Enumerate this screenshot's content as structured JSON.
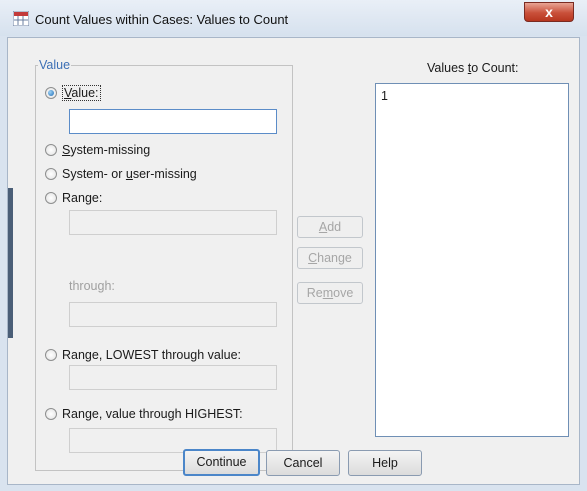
{
  "window": {
    "title": "Count Values within Cases: Values to Count",
    "close_label": "x"
  },
  "value_group": {
    "legend": "Value",
    "options": {
      "value": {
        "pre": "",
        "key": "V",
        "post": "alue:",
        "checked": true
      },
      "system_missing": {
        "pre": "",
        "key": "S",
        "post": "ystem-missing",
        "checked": false
      },
      "system_or_user_missing": {
        "pre": "System- or ",
        "key": "u",
        "post": "ser-missing",
        "checked": false
      },
      "range": {
        "pre": "Ran",
        "key": "g",
        "post": "e:",
        "checked": false
      },
      "range_lowest": {
        "pre": "Range, LOWEST through value:",
        "key": "",
        "post": "",
        "checked": false
      },
      "range_highest": {
        "pre": "Ran",
        "key": "g",
        "post": "e, value through HIGHEST:",
        "checked": false
      }
    },
    "value_input": "",
    "range_from": "",
    "through_label": "through:",
    "range_to": "",
    "lowest_input": "",
    "highest_input": ""
  },
  "list_buttons": {
    "add": {
      "pre": "",
      "key": "A",
      "post": "dd"
    },
    "change": {
      "pre": "",
      "key": "C",
      "post": "hange"
    },
    "remove": {
      "pre": "Re",
      "key": "m",
      "post": "ove"
    }
  },
  "values_to_count": {
    "label": {
      "pre": "Values ",
      "key": "t",
      "post": "o Count:"
    },
    "items": [
      "1"
    ]
  },
  "footer": {
    "continue": "Continue",
    "cancel": "Cancel",
    "help": "Help"
  }
}
